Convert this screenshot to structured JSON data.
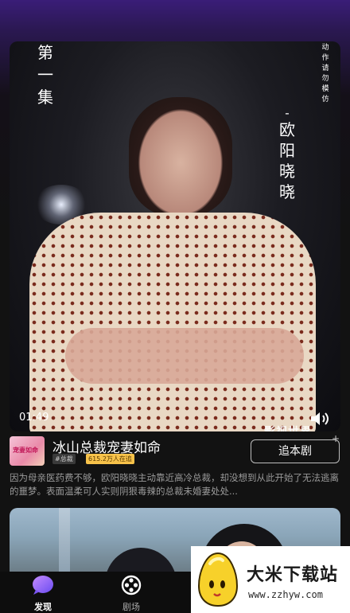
{
  "video": {
    "episode_label": "第一集",
    "character_name": "欧阳晓晓",
    "notice": "动作请勿模仿",
    "current_time": "01:49",
    "subtitle_partial": "影视世界",
    "icons": [
      "volume-icon"
    ]
  },
  "drama": {
    "title": "冰山总裁宠妻如命",
    "thumbnail_text": "宠妻如命",
    "tag_genre": "#总裁",
    "tag_viewers": "615.2万人在追",
    "follow_label": "追本剧",
    "follow_plus": "+",
    "description": "因为母亲医药费不够，欧阳晓晓主动靠近高冷总裁，却没想到从此开始了无法逃离的噩梦。表面温柔可人实则阴狠毒辣的总裁未婚妻处处..."
  },
  "tabbar": {
    "tabs": [
      {
        "label": "发现",
        "icon": "discover-bubble-icon",
        "active": true
      },
      {
        "label": "剧场",
        "icon": "film-reel-icon",
        "active": false
      }
    ]
  },
  "watermark": {
    "name": "大米下载站",
    "url": "www.zzhyw.com"
  },
  "colors": {
    "accent": "#8a5cf6",
    "tag_viewers_bg": "#f7c24a"
  }
}
